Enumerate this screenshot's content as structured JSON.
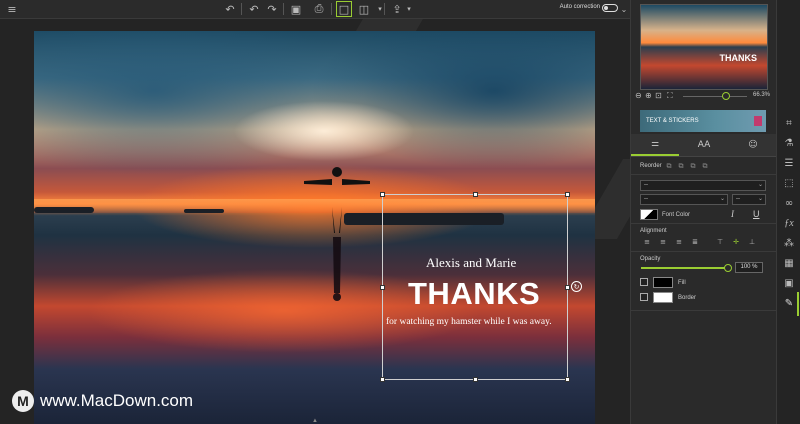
{
  "toolbar": {
    "menu_icon": "hamburger-icon",
    "buttons": [
      {
        "name": "undo",
        "glyph": "↶"
      },
      {
        "name": "undo-step",
        "glyph": "↶"
      },
      {
        "name": "redo",
        "glyph": "↷"
      },
      {
        "name": "save",
        "glyph": "▣"
      },
      {
        "name": "print",
        "glyph": "⎙"
      },
      {
        "name": "single-view",
        "glyph": "□"
      },
      {
        "name": "split-view",
        "glyph": "◫"
      },
      {
        "name": "share",
        "glyph": "⇪"
      }
    ],
    "auto_correction_label": "Auto correction",
    "auto_correction_on": false
  },
  "canvas": {
    "text_names": "Alexis and Marie",
    "text_thanks": "THANKS",
    "text_subtitle": "for watching my hamster while I was away.",
    "rotate_glyph": "↻"
  },
  "watermark": {
    "logo": "M",
    "text": "www.MacDown.com"
  },
  "panel": {
    "thumb_text": "THANKS",
    "zoom_value": "66.3%",
    "zoom_fraction": 0.66,
    "banner_label": "TEXT & STICKERS",
    "tabs": [
      {
        "name": "tab-settings",
        "glyph": "⚌"
      },
      {
        "name": "tab-text",
        "glyph": "AA"
      },
      {
        "name": "tab-stickers",
        "glyph": "☺"
      }
    ],
    "reorder_label": "Reorder",
    "font_select_value": "--",
    "font_style_value": "--",
    "font_size_value": "--",
    "font_color_label": "Font Color",
    "italic_glyph": "I",
    "underline_glyph": "U",
    "alignment_label": "Alignment",
    "opacity_label": "Opacity",
    "opacity_value": "100 %",
    "opacity_fraction": 1.0,
    "fill_label": "Fill",
    "border_label": "Border",
    "accent_color": "#9acd32"
  },
  "rail": {
    "icons": [
      "crop-icon",
      "flask-icon",
      "sliders-icon",
      "selection-icon",
      "glasses-icon",
      "fx-icon",
      "color-balls-icon",
      "grid-icon",
      "frame-icon",
      "text-stickers-icon"
    ]
  }
}
